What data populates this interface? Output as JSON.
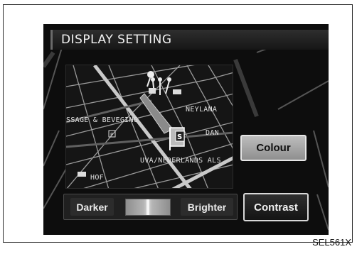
{
  "screen": {
    "title": "DISPLAY SETTING"
  },
  "map": {
    "labels": [
      "NEYLANA",
      "SSAGE & BEVEGING",
      "DAN",
      "UVA/NEDERLANDS ALS",
      "HOF"
    ]
  },
  "buttons": {
    "colour": "Colour",
    "contrast": "Contrast"
  },
  "adjustment": {
    "darker": "Darker",
    "brighter": "Brighter",
    "level_fraction": 0.5
  },
  "figure_code": "SEL561X",
  "colors": {
    "screen_bg": "#0d0d0d",
    "title_text": "#f2f2f2",
    "colour_button": "#a6a6a6",
    "contrast_button": "#1e1e1e"
  }
}
